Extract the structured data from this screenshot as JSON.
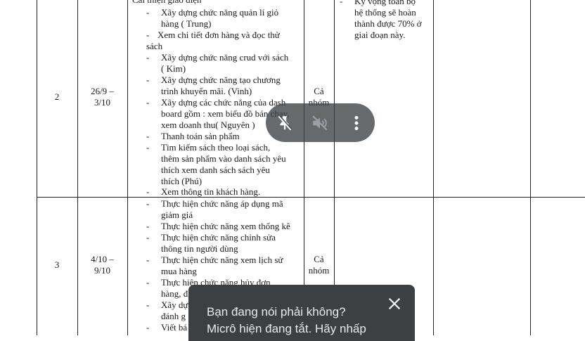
{
  "document": {
    "rows": [
      {
        "stt": "2",
        "time_line1": "26/9 –",
        "time_line2": "3/10",
        "people_line1": "Cả",
        "people_line2": "nhóm",
        "tasks": [
          "Cải thiện giao diện",
          "Xây dựng chức năng quản lí giỏ",
          "hàng ( Trung)",
          "Xem chi tiết đơn hàng và đọc thử",
          "sách",
          "Xây dựng chức năng crud với sách",
          "( Kim)",
          "Xây dựng chức năng  tạo chương",
          "trình khuyến mãi. (Vinh)",
          "Xây dựng các chức năng của dash",
          "board gồm : xem biểu đồ bán chạy,",
          "xem doanh thu( Nguyên )",
          "Thanh toán sản phẩm",
          "Tìm kiếm sách theo loại sách,",
          "thêm sản phẩm vào danh sách yêu",
          "thích xem danh sách sách yêu",
          "thích (Phú)",
          "Xem thông tin khách hàng."
        ],
        "note": [
          "Kỳ vọng toàn bộ",
          "hệ thống sẽ hoàn",
          "thành được 70% ở",
          "giai đoạn này."
        ]
      },
      {
        "stt": "3",
        "time_line1": "4/10 –",
        "time_line2": "9/10",
        "people_line1": "Cả",
        "people_line2": "nhóm",
        "tasks": [
          "Thực hiện chức năng áp dụng mã",
          "giảm giá",
          "Thực hiện chức năng xem thống kê",
          "Thực hiện chức năng chỉnh sửa",
          "thông tin người dùng",
          "Thực hiện chức năng xem lịch sử",
          "mua hàng",
          "Thực hiện chức năng hủy đơn",
          "hàng, đ",
          "Xây dự",
          "đánh g",
          "Viết bá"
        ]
      }
    ]
  },
  "meet_controls": {
    "buttons": [
      "pin-off-icon",
      "volume-off-icon",
      "more-vert-icon"
    ]
  },
  "toast": {
    "line1": "Bạn đang nói phải không?",
    "line2": "Micrô hiện đang tắt. Hãy nhấp"
  }
}
